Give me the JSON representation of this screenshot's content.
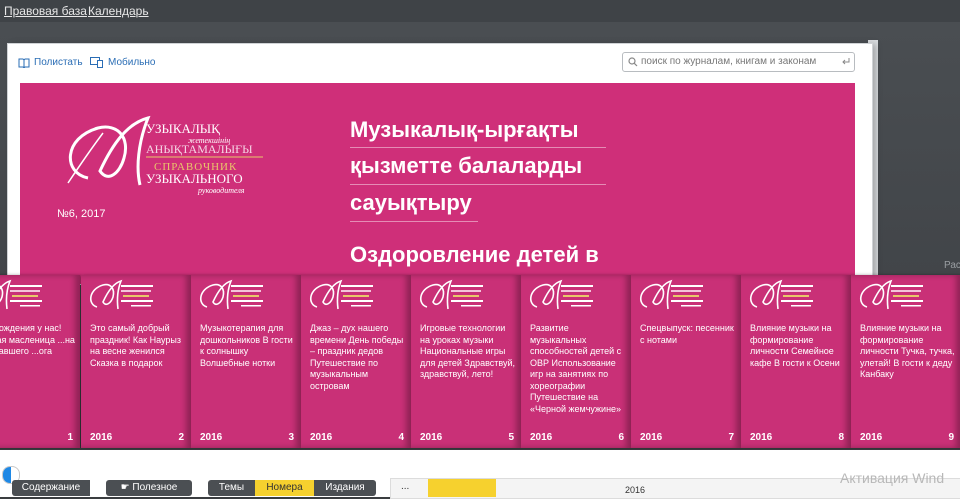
{
  "topbar": {
    "link1": "Правовая база",
    "link2": "Календарь"
  },
  "viewer": {
    "leaf_label": "Полистать",
    "mobile_label": "Мобильно",
    "search_placeholder": "поиск по журналам, книгам и законам"
  },
  "page": {
    "issue": "№6, 2017",
    "heading_lines": [
      "Музыкалық-ырғақты",
      "қызметте балаларды",
      "сауықтыру",
      "Оздоровление детей в"
    ]
  },
  "right_edge_text": "Рас",
  "books": [
    {
      "text": "...я рождения у нас! ...елая масленица ...на пропавшего ...ога",
      "year": "",
      "num": "1"
    },
    {
      "text": "Это самый добрый праздник! Как Наурыз на весне женился Сказка в подарок",
      "year": "2016",
      "num": "2"
    },
    {
      "text": "Музыкотерапия для дошкольников В гости к солнышку Волшебные нотки",
      "year": "2016",
      "num": "3"
    },
    {
      "text": "Джаз – дух нашего времени День победы – праздник дедов Путешествие по музыкальным островам",
      "year": "2016",
      "num": "4"
    },
    {
      "text": "Игровые технологии на уроках музыки Национальные игры для детей Здравствуй, здравствуй, лето!",
      "year": "2016",
      "num": "5"
    },
    {
      "text": "Развитие музыкальных способностей детей с ОВР Использование игр на занятиях по хореографии Путешествие на «Черной жемчужине»",
      "year": "2016",
      "num": "6"
    },
    {
      "text": "Спецвыпуск: песенник с нотами",
      "year": "2016",
      "num": "7"
    },
    {
      "text": "Влияние музыки на формирование личности Семейное кафе В гости к Осени",
      "year": "2016",
      "num": "8"
    },
    {
      "text": "Влияние музыки на формирование личности Тучка, тучка, улетай! В гости к деду Канбаку",
      "year": "2016",
      "num": "9"
    }
  ],
  "bottom": {
    "contents": "Содержание",
    "useful": "Полезное",
    "themes": "Темы",
    "issues": "Номера",
    "editions": "Издания",
    "timeline_dots": "...",
    "timeline_year": "2016",
    "activation": "Активация Wind"
  },
  "colors": {
    "magazine_pink": "#cf2f79",
    "accent_yellow": "#f6d12e",
    "dark_bar": "#4b4f53",
    "link_blue": "#2a6db5"
  }
}
